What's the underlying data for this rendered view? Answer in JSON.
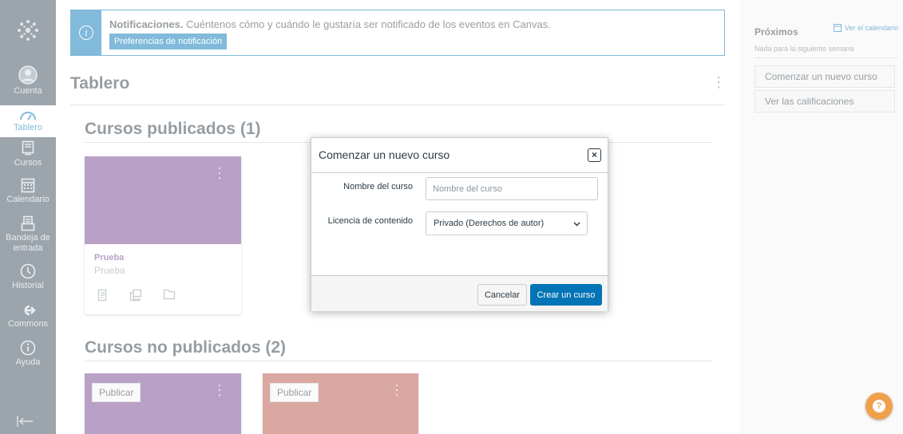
{
  "nav": {
    "items": [
      {
        "label": "Cuenta",
        "icon": "account-icon"
      },
      {
        "label": "Tablero",
        "icon": "dashboard-icon"
      },
      {
        "label": "Cursos",
        "icon": "courses-icon"
      },
      {
        "label": "Calendario",
        "icon": "calendar-icon"
      },
      {
        "label": "Bandeja de entrada",
        "icon": "inbox-icon"
      },
      {
        "label": "Historial",
        "icon": "history-icon"
      },
      {
        "label": "Commons",
        "icon": "commons-icon"
      },
      {
        "label": "Ayuda",
        "icon": "help-icon"
      }
    ],
    "active": "Tablero"
  },
  "notification": {
    "title": "Notificaciones.",
    "message": "Cuéntenos cómo y cuándo le gustaría ser notificado de los eventos en Canvas.",
    "button_label": "Preferencias de notificación"
  },
  "dashboard": {
    "title": "Tablero",
    "published_section": "Cursos publicados (1)",
    "unpublished_section": "Cursos no publicados (2)",
    "published_courses": [
      {
        "name": "Prueba",
        "code": "Prueba",
        "color": "#73418c"
      }
    ],
    "unpublished_courses": [
      {
        "publish_label": "Publicar",
        "color": "#73418c"
      },
      {
        "publish_label": "Publicar",
        "color": "#b44f43"
      }
    ]
  },
  "sidebar": {
    "upcoming_title": "Próximos",
    "calendar_link": "Ver el calendario",
    "empty_message": "Nada para la siguiente semana",
    "new_course_button": "Comenzar un nuevo curso",
    "grades_button": "Ver las calificaciones"
  },
  "modal": {
    "title": "Comenzar un nuevo curso",
    "close_label": "×",
    "course_name_label": "Nombre del curso",
    "course_name_placeholder": "Nombre del curso",
    "course_name_value": "",
    "license_label": "Licencia de contenido",
    "license_value": "Privado (Derechos de autor)",
    "cancel_label": "Cancelar",
    "create_label": "Crear un curso"
  },
  "colors": {
    "nav_bg": "#394b58",
    "brand_blue": "#0374b5",
    "help_orange": "#f0a04b"
  }
}
